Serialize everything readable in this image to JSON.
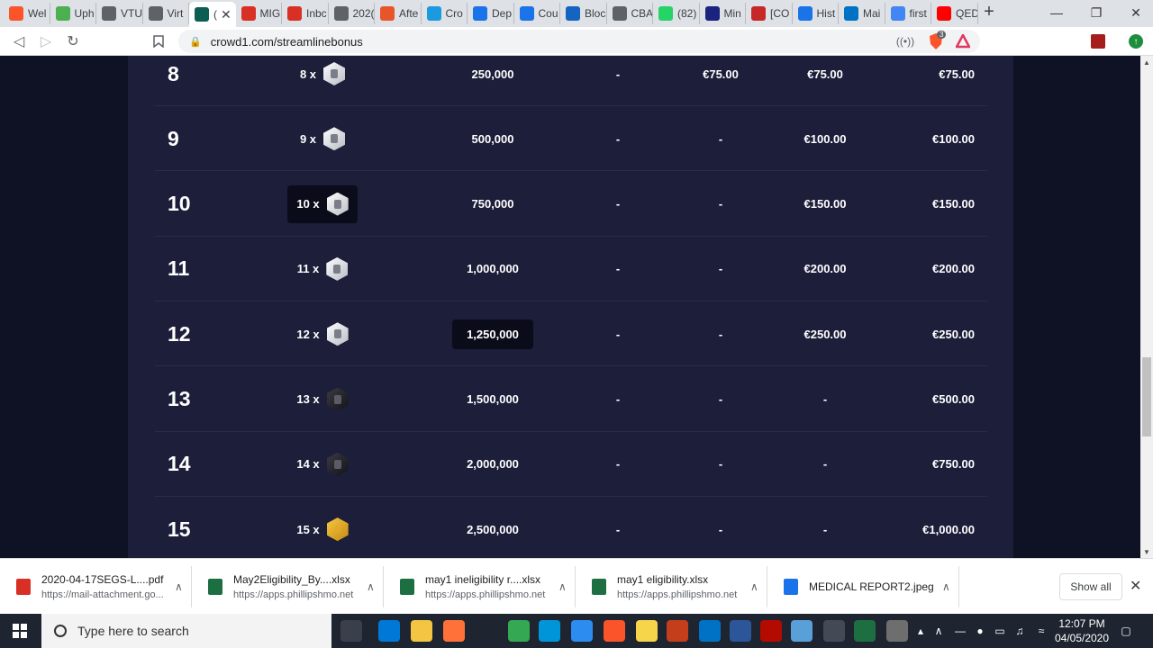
{
  "browser": {
    "tabs": [
      {
        "label": "Wel",
        "icon": "brave-icon",
        "color": "#fb542b"
      },
      {
        "label": "Uph",
        "icon": "pin-icon",
        "color": "#4caf50"
      },
      {
        "label": "VTU",
        "icon": "globe-icon",
        "color": "#5f6368"
      },
      {
        "label": "Virt",
        "icon": "globe-icon",
        "color": "#5f6368"
      },
      {
        "label": "(",
        "icon": "crowd1-icon",
        "color": "#0c5e52",
        "active": true
      },
      {
        "label": "MIG",
        "icon": "gmail-icon",
        "color": "#d93025"
      },
      {
        "label": "Inbc",
        "icon": "gmail-icon",
        "color": "#d93025"
      },
      {
        "label": "202(",
        "icon": "globe-icon",
        "color": "#5f6368"
      },
      {
        "label": "Afte",
        "icon": "edge-like-icon",
        "color": "#e8552b"
      },
      {
        "label": "Cro",
        "icon": "v-icon",
        "color": "#1a9be0"
      },
      {
        "label": "Dep",
        "icon": "p-icon",
        "color": "#1a73e8"
      },
      {
        "label": "Cou",
        "icon": "p-icon",
        "color": "#1a73e8"
      },
      {
        "label": "Bloc",
        "icon": "diamond-icon",
        "color": "#1565c0"
      },
      {
        "label": "CBA",
        "icon": "globe-icon",
        "color": "#5f6368"
      },
      {
        "label": "(82)",
        "icon": "whatsapp-icon",
        "color": "#25d366"
      },
      {
        "label": "Min",
        "icon": "c-icon",
        "color": "#1a237e"
      },
      {
        "label": "[CO",
        "icon": "doc-icon",
        "color": "#c62828"
      },
      {
        "label": "Hist",
        "icon": "history-icon",
        "color": "#1a73e8"
      },
      {
        "label": "Mai",
        "icon": "outlook-icon",
        "color": "#0072c6"
      },
      {
        "label": "first",
        "icon": "google-icon",
        "color": "#4285f4"
      },
      {
        "label": "QED",
        "icon": "youtube-icon",
        "color": "#ff0000"
      }
    ],
    "url": "crowd1.com/streamlinebonus",
    "shield_count": "3"
  },
  "table": {
    "rows": [
      {
        "level": "8",
        "badge_label": "8 x",
        "badge": "silver",
        "points": "250,000",
        "c4": "-",
        "c5": "€75.00",
        "c6": "€75.00",
        "c7": "€75.00",
        "badge_hl": false,
        "points_hl": false
      },
      {
        "level": "9",
        "badge_label": "9 x",
        "badge": "silver",
        "points": "500,000",
        "c4": "-",
        "c5": "-",
        "c6": "€100.00",
        "c7": "€100.00",
        "badge_hl": false,
        "points_hl": false
      },
      {
        "level": "10",
        "badge_label": "10 x",
        "badge": "silver",
        "points": "750,000",
        "c4": "-",
        "c5": "-",
        "c6": "€150.00",
        "c7": "€150.00",
        "badge_hl": true,
        "points_hl": false
      },
      {
        "level": "11",
        "badge_label": "11 x",
        "badge": "silver",
        "points": "1,000,000",
        "c4": "-",
        "c5": "-",
        "c6": "€200.00",
        "c7": "€200.00",
        "badge_hl": false,
        "points_hl": false
      },
      {
        "level": "12",
        "badge_label": "12 x",
        "badge": "silver",
        "points": "1,250,000",
        "c4": "-",
        "c5": "-",
        "c6": "€250.00",
        "c7": "€250.00",
        "badge_hl": false,
        "points_hl": true
      },
      {
        "level": "13",
        "badge_label": "13 x",
        "badge": "black",
        "points": "1,500,000",
        "c4": "-",
        "c5": "-",
        "c6": "-",
        "c7": "€500.00",
        "badge_hl": false,
        "points_hl": false
      },
      {
        "level": "14",
        "badge_label": "14 x",
        "badge": "black",
        "points": "2,000,000",
        "c4": "-",
        "c5": "-",
        "c6": "-",
        "c7": "€750.00",
        "badge_hl": false,
        "points_hl": false
      },
      {
        "level": "15",
        "badge_label": "15 x",
        "badge": "gold",
        "points": "2,500,000",
        "c4": "-",
        "c5": "-",
        "c6": "-",
        "c7": "€1,000.00",
        "badge_hl": false,
        "points_hl": false
      }
    ]
  },
  "downloads": {
    "items": [
      {
        "name": "2020-04-17SEGS-L....pdf",
        "source": "https://mail-attachment.go...",
        "type": "pdf"
      },
      {
        "name": "May2Eligibility_By....xlsx",
        "source": "https://apps.phillipshmo.net",
        "type": "xlsx"
      },
      {
        "name": "may1 ineligibility r....xlsx",
        "source": "https://apps.phillipshmo.net",
        "type": "xlsx"
      },
      {
        "name": "may1 eligibility.xlsx",
        "source": "https://apps.phillipshmo.net",
        "type": "xlsx"
      },
      {
        "name": "MEDICAL REPORT2.jpeg",
        "source": "",
        "type": "jpeg"
      }
    ],
    "show_all": "Show all"
  },
  "taskbar": {
    "search_placeholder": "Type here to search",
    "time": "12:07 PM",
    "date": "04/05/2020"
  }
}
